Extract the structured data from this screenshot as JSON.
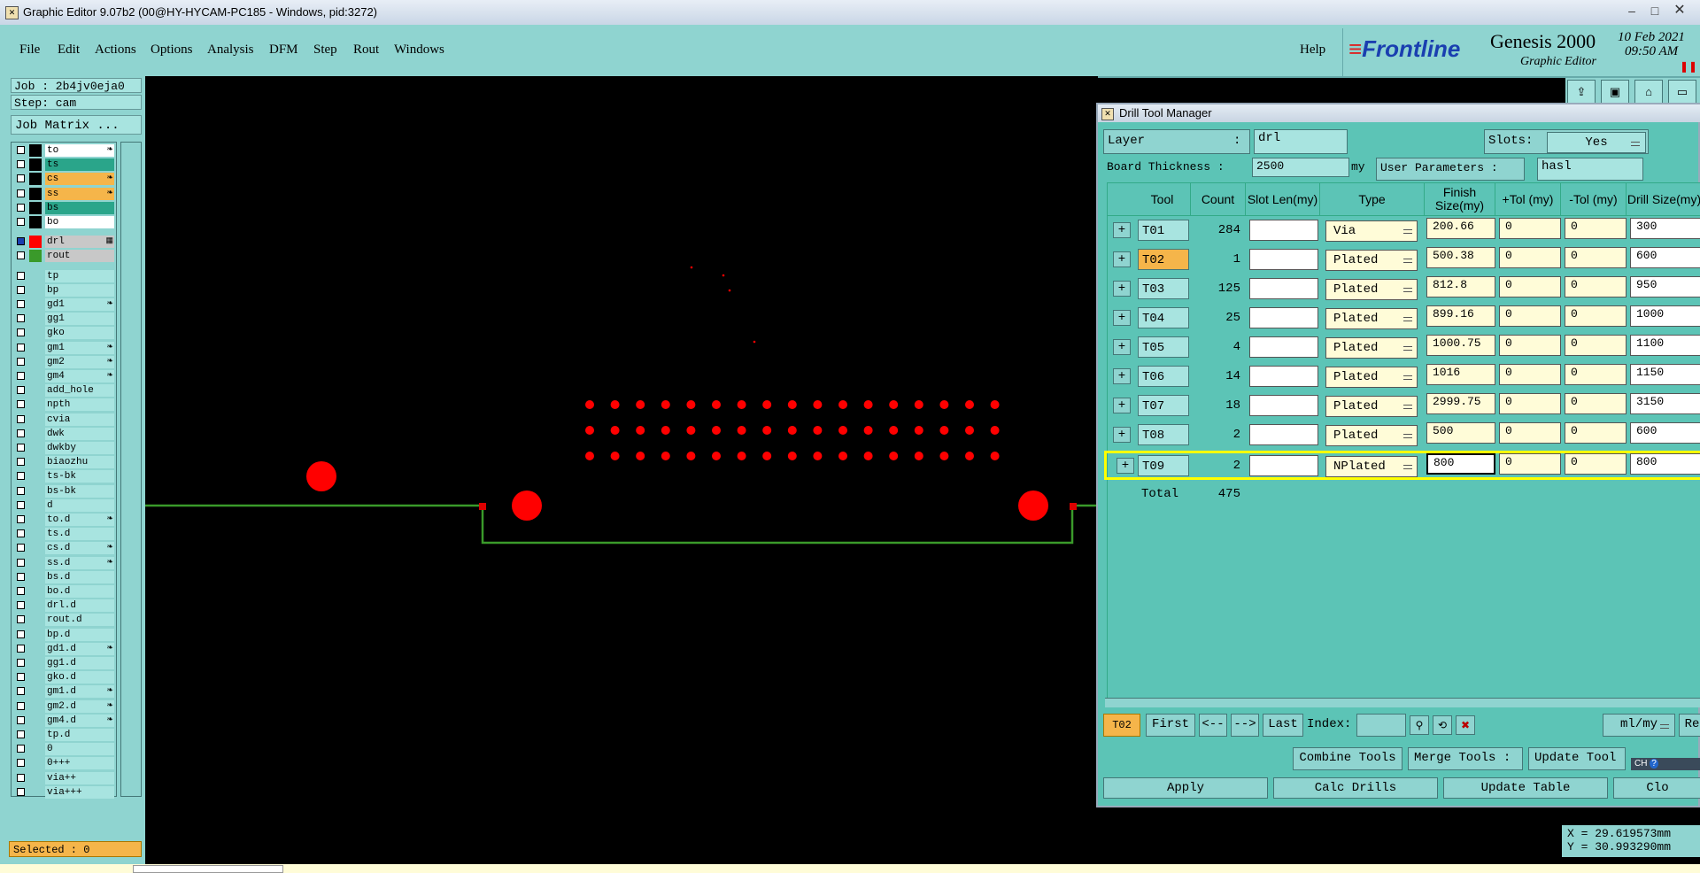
{
  "window": {
    "title": "Graphic Editor 9.07b2 (00@HY-HYCAM-PC185 - Windows, pid:3272)"
  },
  "menu": [
    "File",
    "Edit",
    "Actions",
    "Options",
    "Analysis",
    "DFM",
    "Step",
    "Rout",
    "Windows"
  ],
  "help": "Help",
  "brand": {
    "logo": "Frontline",
    "product": "Genesis 2000",
    "subtitle": "Graphic Editor",
    "date": "10 Feb 2021",
    "time": "09:50 AM"
  },
  "job": {
    "job": "Job : 2b4jv0eja0",
    "step": "Step: cam",
    "matrix_button": "Job Matrix ..."
  },
  "layers": [
    {
      "name": "to",
      "color": "#000000",
      "bg": "#ffffff",
      "flag": "❧"
    },
    {
      "name": "ts",
      "color": "#000000",
      "bg": "#2aa58a",
      "flag": ""
    },
    {
      "name": "cs",
      "color": "#000000",
      "bg": "#f5b54a",
      "flag": "❧"
    },
    {
      "name": "ss",
      "color": "#000000",
      "bg": "#f5b54a",
      "flag": "❧"
    },
    {
      "name": "bs",
      "color": "#000000",
      "bg": "#2aa58a",
      "flag": ""
    },
    {
      "name": "bo",
      "color": "#000000",
      "bg": "#ffffff",
      "flag": ""
    },
    {
      "name": "drl",
      "color": "#ff0000",
      "bg": "#c8c8c8",
      "flag": "▦"
    },
    {
      "name": "rout",
      "color": "#3a9a2a",
      "bg": "#c8c8c8",
      "flag": ""
    },
    {
      "name": "tp",
      "color": "",
      "bg": "#a8e4e0",
      "flag": ""
    },
    {
      "name": "bp",
      "color": "",
      "bg": "#a8e4e0",
      "flag": ""
    },
    {
      "name": "gd1",
      "color": "",
      "bg": "#a8e4e0",
      "flag": "❧"
    },
    {
      "name": "gg1",
      "color": "",
      "bg": "#a8e4e0",
      "flag": ""
    },
    {
      "name": "gko",
      "color": "",
      "bg": "#a8e4e0",
      "flag": ""
    },
    {
      "name": "gm1",
      "color": "",
      "bg": "#a8e4e0",
      "flag": "❧"
    },
    {
      "name": "gm2",
      "color": "",
      "bg": "#a8e4e0",
      "flag": "❧"
    },
    {
      "name": "gm4",
      "color": "",
      "bg": "#a8e4e0",
      "flag": "❧"
    },
    {
      "name": "add_hole",
      "color": "",
      "bg": "#a8e4e0",
      "flag": ""
    },
    {
      "name": "npth",
      "color": "",
      "bg": "#a8e4e0",
      "flag": ""
    },
    {
      "name": "cvia",
      "color": "",
      "bg": "#a8e4e0",
      "flag": ""
    },
    {
      "name": "dwk",
      "color": "",
      "bg": "#a8e4e0",
      "flag": ""
    },
    {
      "name": "dwkby",
      "color": "",
      "bg": "#a8e4e0",
      "flag": ""
    },
    {
      "name": "biaozhu",
      "color": "",
      "bg": "#a8e4e0",
      "flag": ""
    },
    {
      "name": "ts-bk",
      "color": "",
      "bg": "#a8e4e0",
      "flag": ""
    },
    {
      "name": "bs-bk",
      "color": "",
      "bg": "#a8e4e0",
      "flag": ""
    },
    {
      "name": "d",
      "color": "",
      "bg": "#a8e4e0",
      "flag": ""
    },
    {
      "name": "to.d",
      "color": "",
      "bg": "#a8e4e0",
      "flag": "❧"
    },
    {
      "name": "ts.d",
      "color": "",
      "bg": "#a8e4e0",
      "flag": ""
    },
    {
      "name": "cs.d",
      "color": "",
      "bg": "#a8e4e0",
      "flag": "❧"
    },
    {
      "name": "ss.d",
      "color": "",
      "bg": "#a8e4e0",
      "flag": "❧"
    },
    {
      "name": "bs.d",
      "color": "",
      "bg": "#a8e4e0",
      "flag": ""
    },
    {
      "name": "bo.d",
      "color": "",
      "bg": "#a8e4e0",
      "flag": ""
    },
    {
      "name": "drl.d",
      "color": "",
      "bg": "#a8e4e0",
      "flag": ""
    },
    {
      "name": "rout.d",
      "color": "",
      "bg": "#a8e4e0",
      "flag": ""
    },
    {
      "name": "bp.d",
      "color": "",
      "bg": "#a8e4e0",
      "flag": ""
    },
    {
      "name": "gd1.d",
      "color": "",
      "bg": "#a8e4e0",
      "flag": "❧"
    },
    {
      "name": "gg1.d",
      "color": "",
      "bg": "#a8e4e0",
      "flag": ""
    },
    {
      "name": "gko.d",
      "color": "",
      "bg": "#a8e4e0",
      "flag": ""
    },
    {
      "name": "gm1.d",
      "color": "",
      "bg": "#a8e4e0",
      "flag": "❧"
    },
    {
      "name": "gm2.d",
      "color": "",
      "bg": "#a8e4e0",
      "flag": "❧"
    },
    {
      "name": "gm4.d",
      "color": "",
      "bg": "#a8e4e0",
      "flag": "❧"
    },
    {
      "name": "tp.d",
      "color": "",
      "bg": "#a8e4e0",
      "flag": ""
    },
    {
      "name": "0",
      "color": "",
      "bg": "#a8e4e0",
      "flag": ""
    },
    {
      "name": "0+++",
      "color": "",
      "bg": "#a8e4e0",
      "flag": ""
    },
    {
      "name": "via++",
      "color": "",
      "bg": "#a8e4e0",
      "flag": ""
    },
    {
      "name": "via+++",
      "color": "",
      "bg": "#a8e4e0",
      "flag": ""
    }
  ],
  "selected": "Selected : 0",
  "coords": {
    "x": "X = 29.619573mm",
    "y": "Y = 30.993290mm"
  },
  "dialog": {
    "title": "Drill Tool Manager",
    "layer_label": "Layer",
    "layer_colon": ":",
    "layer_value": "drl",
    "slots_label": "Slots:",
    "slots_value": "Yes",
    "thickness_label": "Board Thickness :",
    "thickness_value": "2500",
    "thickness_unit": "my",
    "user_params_label": "User Parameters :",
    "user_params_value": "hasl",
    "columns": [
      "Tool",
      "Count",
      "Slot Len(my)",
      "Type",
      "Finish Size(my)",
      "+Tol (my)",
      "-Tol (my)",
      "Drill Size(my)"
    ],
    "rows": [
      {
        "tool": "T01",
        "count": "284",
        "slot": "",
        "type": "Via",
        "finish": "200.66",
        "ptol": "0",
        "mtol": "0",
        "drill": "300"
      },
      {
        "tool": "T02",
        "count": "1",
        "slot": "",
        "type": "Plated",
        "finish": "500.38",
        "ptol": "0",
        "mtol": "0",
        "drill": "600"
      },
      {
        "tool": "T03",
        "count": "125",
        "slot": "",
        "type": "Plated",
        "finish": "812.8",
        "ptol": "0",
        "mtol": "0",
        "drill": "950"
      },
      {
        "tool": "T04",
        "count": "25",
        "slot": "",
        "type": "Plated",
        "finish": "899.16",
        "ptol": "0",
        "mtol": "0",
        "drill": "1000"
      },
      {
        "tool": "T05",
        "count": "4",
        "slot": "",
        "type": "Plated",
        "finish": "1000.75",
        "ptol": "0",
        "mtol": "0",
        "drill": "1100"
      },
      {
        "tool": "T06",
        "count": "14",
        "slot": "",
        "type": "Plated",
        "finish": "1016",
        "ptol": "0",
        "mtol": "0",
        "drill": "1150"
      },
      {
        "tool": "T07",
        "count": "18",
        "slot": "",
        "type": "Plated",
        "finish": "2999.75",
        "ptol": "0",
        "mtol": "0",
        "drill": "3150"
      },
      {
        "tool": "T08",
        "count": "2",
        "slot": "",
        "type": "Plated",
        "finish": "500",
        "ptol": "0",
        "mtol": "0",
        "drill": "600"
      },
      {
        "tool": "T09",
        "count": "2",
        "slot": "",
        "type": "NPlated",
        "finish": "800",
        "ptol": "0",
        "mtol": "0",
        "drill": "800"
      }
    ],
    "total_label": "Total",
    "total_count": "475",
    "nav": {
      "current": "T02",
      "first": "First",
      "prev": "<--",
      "next": "-->",
      "last": "Last",
      "index_label": "Index:",
      "units": "ml/my",
      "reset": "Re"
    },
    "actions": {
      "combine": "Combine Tools",
      "merge": "Merge Tools :",
      "update_tools": "Update Tool"
    },
    "bottom": {
      "apply": "Apply",
      "calc": "Calc Drills",
      "update_table": "Update Table",
      "close": "Clo"
    },
    "ime": "CH"
  },
  "colors": {
    "panel": "#8fd4d0",
    "dialog": "#5cc4b6",
    "drill": "#ff0000",
    "rout": "#3a9a2a",
    "highlight": "#ffff00",
    "orange": "#f5b54a"
  }
}
